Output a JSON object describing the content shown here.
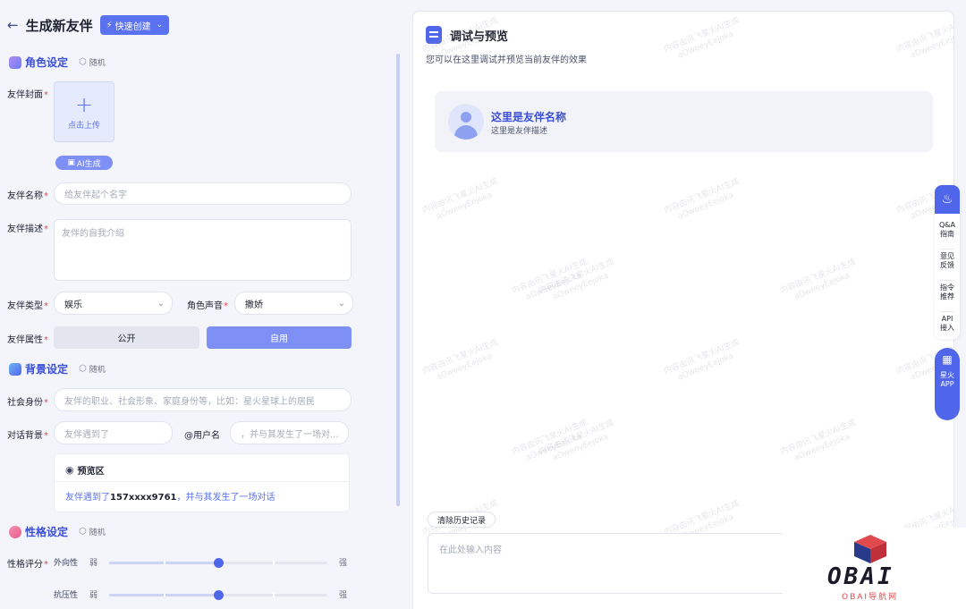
{
  "header": {
    "title": "生成新友伴",
    "quick_create_label": "快速创建"
  },
  "sections": {
    "role": {
      "title": "角色设定",
      "random": "随机"
    },
    "background": {
      "title": "背景设定",
      "random": "随机"
    },
    "personality": {
      "title": "性格设定",
      "random": "随机"
    }
  },
  "form": {
    "cover_label": "友伴封面",
    "upload_label": "点击上传",
    "ai_generate_label": "AI生成",
    "name_label": "友伴名称",
    "name_placeholder": "给友伴起个名字",
    "desc_label": "友伴描述",
    "desc_placeholder": "友伴的自我介绍",
    "type_label": "友伴类型",
    "type_value": "娱乐",
    "voice_label": "角色声音",
    "voice_value": "撒娇",
    "attr_label": "友伴属性",
    "attr_options": [
      "公开",
      "自用"
    ],
    "attr_selected": "自用",
    "identity_label": "社会身份",
    "identity_placeholder": "友伴的职业、社会形象、家庭身份等，比如：星火星球上的居民",
    "dialog_label": "对话背景",
    "dialog_placeholder_1": "友伴遇到了",
    "username_tag": "@用户名",
    "dialog_placeholder_2": "，并与其发生了一场对...",
    "preview_title": "预览区",
    "preview_prefix": "友伴遇到了",
    "preview_user": "157xxxx9761",
    "preview_suffix": "，并与其发生了一场对话",
    "score_label": "性格评分",
    "traits": [
      {
        "name": "外向性",
        "weak": "弱",
        "strong": "强",
        "value": 0.5
      },
      {
        "name": "抗压性",
        "weak": "弱",
        "strong": "强",
        "value": 0.5
      }
    ]
  },
  "preview_panel": {
    "title": "调试与预览",
    "subtitle": "您可以在这里调试并预览当前友伴的效果",
    "companion_name": "这里是友伴名称",
    "companion_desc": "这里是友伴描述",
    "clear_history": "清除历史记录",
    "input_placeholder": "在此处输入内容",
    "watermark_line1": "内容由讯飞星火AI生成",
    "watermark_line2": "aOweeyEejoka"
  },
  "side_rail": {
    "items": [
      "Q&A\n指南",
      "意见\n反馈",
      "指令\n推荐",
      "API\n接入"
    ],
    "app_label": "星火\nAPP"
  },
  "logo": {
    "text": "OBAI",
    "sub": "OBAI导航网"
  },
  "colors": {
    "accent": "#4f66ea",
    "accent_light": "#7e8ff5",
    "required": "#e5484d"
  }
}
